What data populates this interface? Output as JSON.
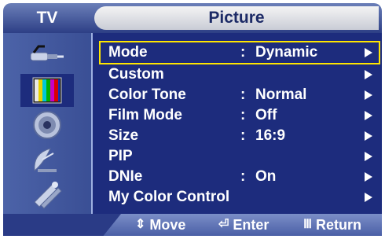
{
  "header": {
    "category": "TV",
    "title": "Picture"
  },
  "sidebar": {
    "items": [
      {
        "icon": "input-plug-icon"
      },
      {
        "icon": "color-bars-icon"
      },
      {
        "icon": "speaker-icon"
      },
      {
        "icon": "satellite-dish-icon"
      },
      {
        "icon": "setup-tools-icon"
      }
    ]
  },
  "menu": {
    "items": [
      {
        "label": "Mode",
        "colon": ":",
        "value": "Dynamic",
        "selected": true
      },
      {
        "label": "Custom",
        "colon": "",
        "value": ""
      },
      {
        "label": "Color Tone",
        "colon": ":",
        "value": "Normal"
      },
      {
        "label": "Film Mode",
        "colon": ":",
        "value": "Off"
      },
      {
        "label": "Size",
        "colon": ":",
        "value": "16:9"
      },
      {
        "label": "PIP",
        "colon": "",
        "value": ""
      },
      {
        "label": "DNIe",
        "colon": ":",
        "value": "On"
      },
      {
        "label": "My Color Control",
        "colon": "",
        "value": ""
      }
    ]
  },
  "footer": {
    "move": {
      "icon": "⇕",
      "label": "Move"
    },
    "enter": {
      "icon": "⏎",
      "label": "Enter"
    },
    "return": {
      "icon": "Ⅲ",
      "label": "Return"
    }
  },
  "colors": {
    "panel": "#1d2c7d",
    "highlight": "#ffe600",
    "header": "#2d3f86"
  }
}
